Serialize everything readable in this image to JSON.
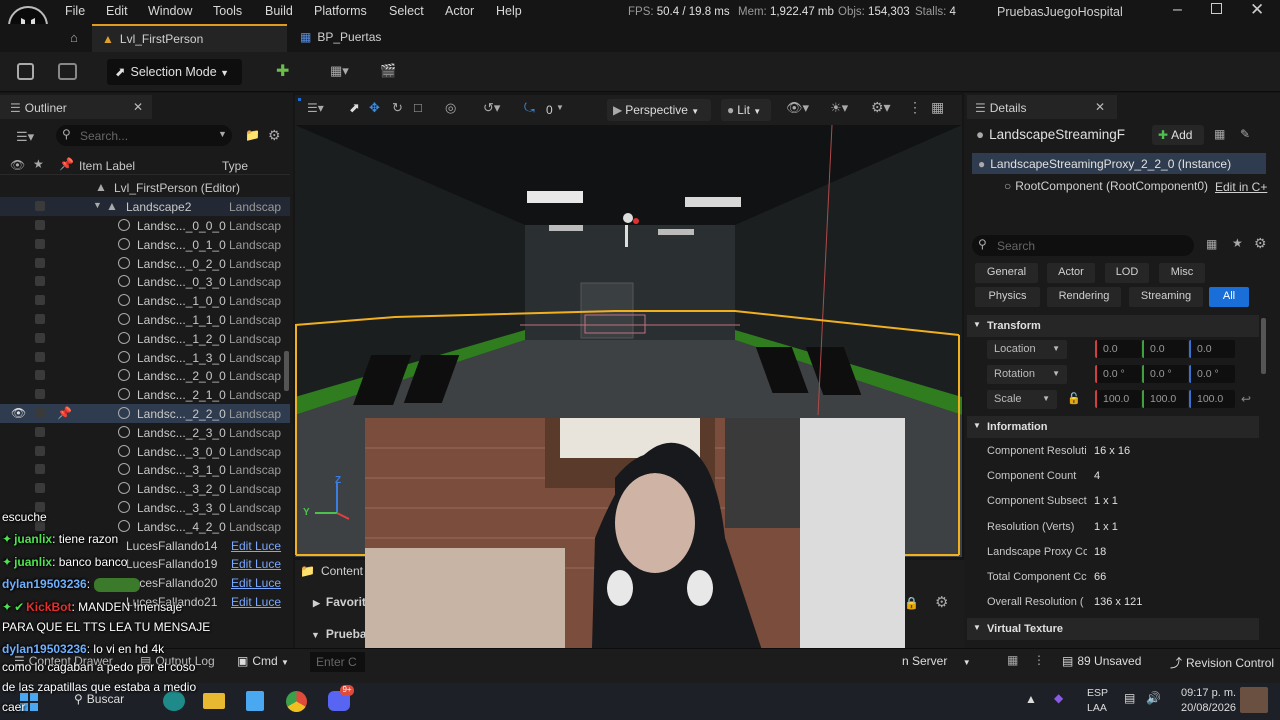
{
  "titlebar": {
    "menu": [
      "File",
      "Edit",
      "Window",
      "Tools",
      "Build",
      "Platforms",
      "Select",
      "Actor",
      "Help"
    ],
    "stats": {
      "fps_label": "FPS:",
      "fps_value": "50.4 / 19.8 ms",
      "mem_label": "Mem:",
      "mem_value": "1,922.47 mb",
      "objs_label": "Objs:",
      "objs_value": "154,303",
      "stalls_label": "Stalls:",
      "stalls_value": "4"
    },
    "project_name": "PruebasJuegoHospital"
  },
  "tabs": [
    {
      "label": "Lvl_FirstPerson"
    },
    {
      "label": "BP_Puertas"
    }
  ],
  "toolbar": {
    "selection_mode": "Selection Mode"
  },
  "outliner": {
    "title": "Outliner",
    "search_placeholder": "Search...",
    "col_label": "Item Label",
    "col_type": "Type",
    "root": "Lvl_FirstPerson (Editor)",
    "landscape": {
      "label": "Landscape2",
      "type": "Landscap"
    },
    "items": [
      {
        "label": "Landsc..._0_0_0",
        "type": "Landscap"
      },
      {
        "label": "Landsc..._0_1_0",
        "type": "Landscap"
      },
      {
        "label": "Landsc..._0_2_0",
        "type": "Landscap"
      },
      {
        "label": "Landsc..._0_3_0",
        "type": "Landscap"
      },
      {
        "label": "Landsc..._1_0_0",
        "type": "Landscap"
      },
      {
        "label": "Landsc..._1_1_0",
        "type": "Landscap"
      },
      {
        "label": "Landsc..._1_2_0",
        "type": "Landscap"
      },
      {
        "label": "Landsc..._1_3_0",
        "type": "Landscap"
      },
      {
        "label": "Landsc..._2_0_0",
        "type": "Landscap"
      },
      {
        "label": "Landsc..._2_1_0",
        "type": "Landscap"
      },
      {
        "label": "Landsc..._2_2_0",
        "type": "Landscap"
      },
      {
        "label": "Landsc..._2_3_0",
        "type": "Landscap"
      },
      {
        "label": "Landsc..._3_0_0",
        "type": "Landscap"
      },
      {
        "label": "Landsc..._3_1_0",
        "type": "Landscap"
      },
      {
        "label": "Landsc..._3_2_0",
        "type": "Landscap"
      },
      {
        "label": "Landsc..._3_3_0",
        "type": "Landscap"
      },
      {
        "label": "Landsc..._4_2_0",
        "type": "Landscap"
      }
    ],
    "lights": [
      {
        "label": "LucesFallando14",
        "type": "Edit Luce"
      },
      {
        "label": "LucesFallando19",
        "type": "Edit Luce"
      },
      {
        "label": "LucesFallando20",
        "type": "Edit Luce"
      },
      {
        "label": "LucesFallando21",
        "type": "Edit Luce"
      }
    ]
  },
  "viewport": {
    "snap_value": "0",
    "perspective": "Perspective",
    "lit": "Lit",
    "axis_z": "Z",
    "axis_y": "Y"
  },
  "content": {
    "title": "Content",
    "favorites": "Favorit",
    "folder": "Prueba"
  },
  "details": {
    "title": "Details",
    "actor_name": "LandscapeStreamingF",
    "add_label": "Add",
    "instance": "LandscapeStreamingProxy_2_2_0 (Instance)",
    "root_component": "RootComponent (RootComponent0)",
    "edit_in_cpp": "Edit in C+",
    "search_placeholder": "Search",
    "filters_row1": [
      "General",
      "Actor",
      "LOD",
      "Misc"
    ],
    "filters_row2": [
      "Physics",
      "Rendering",
      "Streaming",
      "All"
    ],
    "transform": {
      "title": "Transform",
      "location_label": "Location",
      "location": [
        "0.0",
        "0.0",
        "0.0"
      ],
      "rotation_label": "Rotation",
      "rotation": [
        "0.0 °",
        "0.0 °",
        "0.0 °"
      ],
      "scale_label": "Scale",
      "scale": [
        "100.0",
        "100.0",
        "100.0"
      ]
    },
    "information": {
      "title": "Information",
      "rows": [
        {
          "key": "Component Resoluti",
          "value": "16 x 16"
        },
        {
          "key": "Component Count",
          "value": "4"
        },
        {
          "key": "Component Subsect",
          "value": "1 x 1"
        },
        {
          "key": "Resolution (Verts)",
          "value": "1 x 1"
        },
        {
          "key": "Landscape Proxy Cc",
          "value": "18"
        },
        {
          "key": "Total Component Cc",
          "value": "66"
        },
        {
          "key": "Overall Resolution (",
          "value": "136 x 121"
        }
      ]
    },
    "virtual_texture": "Virtual Texture"
  },
  "statusbar": {
    "content_drawer": "Content Drawer",
    "output_log": "Output Log",
    "cmd": "Cmd",
    "console_placeholder": "Enter C",
    "server": "n Server",
    "unsaved": "89 Unsaved",
    "revision": "Revision Control"
  },
  "chat": [
    {
      "user": "",
      "text": "escuche"
    },
    {
      "user": "juanlix",
      "text": ": tiene razon"
    },
    {
      "user": "juanlix",
      "text": ": banco banco"
    },
    {
      "user": "dylan19503236",
      "text": ":"
    },
    {
      "user": "KickBot",
      "text": ": MANDEN !mensaje"
    },
    {
      "user": "",
      "text": "PARA QUE EL TTS LEA TU MENSAJE"
    },
    {
      "user": "dylan19503236",
      "text": ": lo vi en hd 4k"
    },
    {
      "user": "",
      "text": "como lo cagaban a pedo por el coso"
    },
    {
      "user": "",
      "text": "de las zapatillas que estaba a medio"
    },
    {
      "user": "",
      "text": "caer"
    }
  ],
  "taskbar": {
    "search": "Buscar",
    "lang1": "ESP",
    "lang2": "LAA",
    "time": "09:17 p. m.",
    "date": "20/08/2026",
    "badge": "9+"
  },
  "colors": {
    "accent_blue": "#1a6ed8",
    "play_green": "#3fbf3f",
    "selection_yellow": "#f0b020",
    "chat_user_green": "#4fe24f",
    "kickbot_red": "#e03030"
  }
}
